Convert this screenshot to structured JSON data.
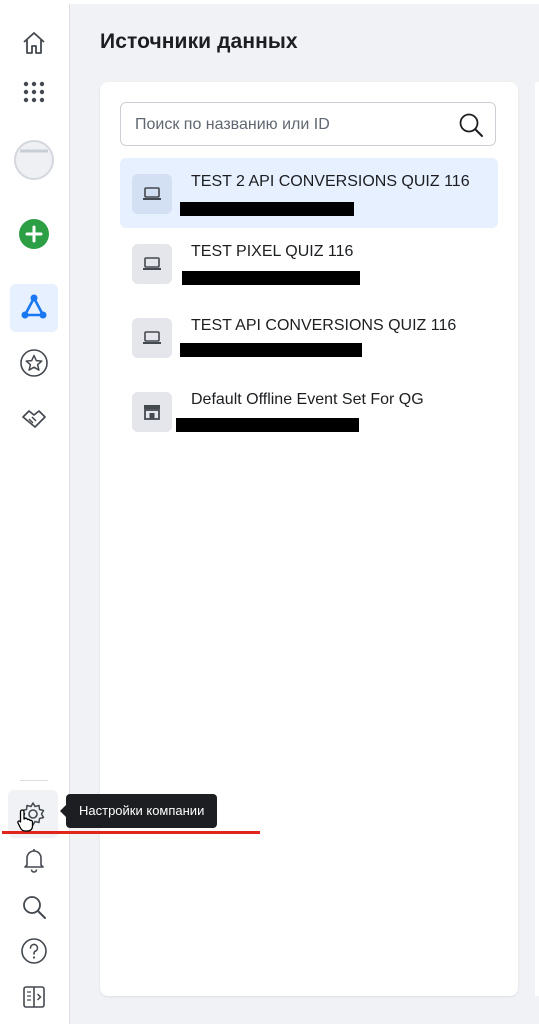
{
  "page": {
    "title": "Источники данных"
  },
  "search": {
    "placeholder": "Поиск по названию или ID"
  },
  "sources": [
    {
      "name": "TEST 2 API CONVERSIONS QUIZ 116",
      "icon": "laptop-icon",
      "selected": true
    },
    {
      "name": "TEST PIXEL QUIZ 116",
      "icon": "laptop-icon",
      "selected": false
    },
    {
      "name": "TEST API CONVERSIONS QUIZ 116",
      "icon": "laptop-icon",
      "selected": false
    },
    {
      "name": "Default Offline Event Set For QG",
      "icon": "store-icon",
      "selected": false
    }
  ],
  "sidebar": {
    "items": [
      {
        "icon": "home-icon"
      },
      {
        "icon": "apps-grid-icon"
      },
      {
        "icon": "account-avatar-icon"
      },
      {
        "icon": "create-plus-icon"
      },
      {
        "icon": "events-manager-icon",
        "active": true
      },
      {
        "icon": "star-icon"
      },
      {
        "icon": "partnership-icon"
      },
      {
        "icon": "gear-icon"
      },
      {
        "icon": "bell-icon"
      },
      {
        "icon": "search-icon"
      },
      {
        "icon": "help-icon"
      },
      {
        "icon": "collapse-sidebar-icon"
      }
    ]
  },
  "tooltip": {
    "text": "Настройки компании"
  },
  "colors": {
    "accent": "#1877f2",
    "create": "#2c9f45",
    "highlight": "#e7f0ff",
    "annotation": "#e0261a"
  }
}
